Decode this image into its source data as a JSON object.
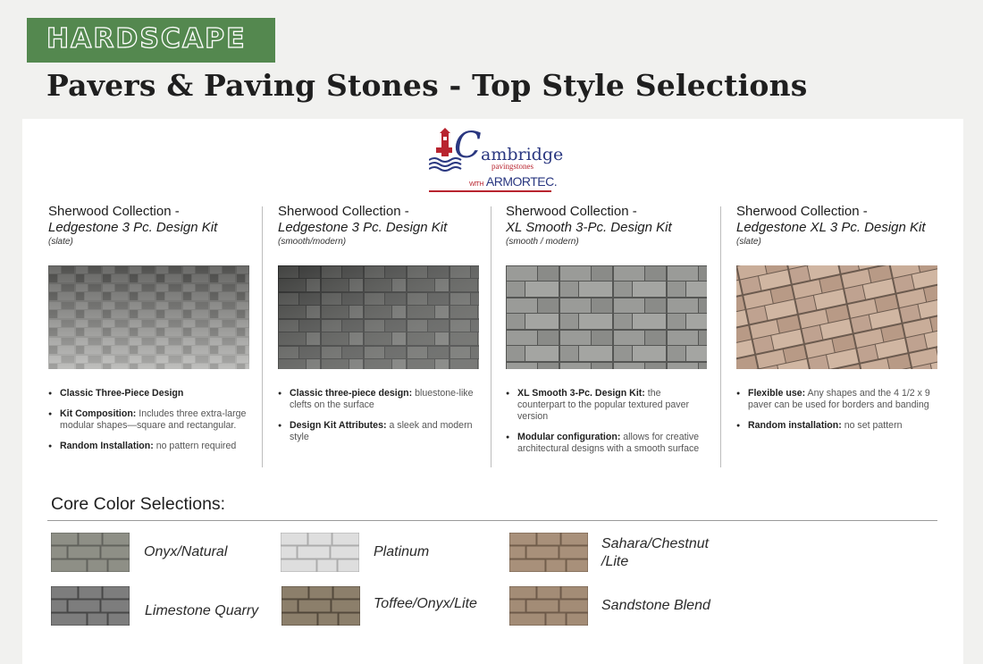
{
  "banner": {
    "label": "HARDSCAPE"
  },
  "title": "Pavers & Paving Stones - Top Style Selections",
  "logo": {
    "initial": "C",
    "name_rest": "ambridge",
    "sub": "pavingstones",
    "with": "WITH",
    "armor": "ARMORTEC."
  },
  "collections": [
    {
      "title": "Sherwood Collection  -",
      "subtitle": "Ledgestone 3 Pc. Design Kit",
      "note": "(slate)",
      "image": "paver-slate",
      "bullets": [
        {
          "bold": "Classic Three-Piece Design",
          "text": ""
        },
        {
          "bold": "Kit Composition:",
          "text": " Includes three extra-large modular shapes—square and rectangular."
        },
        {
          "bold": "Random Installation:",
          "text": " no pattern required"
        }
      ]
    },
    {
      "title": "Sherwood Collection  -",
      "subtitle": "Ledgestone 3 Pc. Design Kit",
      "note": "(smooth/modern)",
      "image": "paver-smooth",
      "bullets": [
        {
          "bold": "Classic three-piece design:",
          "text": " bluestone-like clefts on the surface"
        },
        {
          "bold": "Design Kit Attributes:",
          "text": " a sleek and modern style"
        }
      ]
    },
    {
      "title": "Sherwood Collection  -",
      "subtitle": "XL Smooth 3-Pc. Design Kit",
      "note": "(smooth / modern)",
      "image": "paver-xl-smooth",
      "bullets": [
        {
          "bold": "XL Smooth 3-Pc. Design Kit:",
          "text": " the counterpart to the popular textured paver version"
        },
        {
          "bold": "Modular configuration:",
          "text": " allows for creative architectural designs with a smooth surface"
        }
      ]
    },
    {
      "title": "Sherwood Collection  -",
      "subtitle": "Ledgestone XL 3 Pc. Design Kit",
      "note": "(slate)",
      "image": "paver-xl-slate",
      "bullets": [
        {
          "bold": "Flexible use:",
          "text": " Any shapes and the 4 1/2 x 9 paver can be used for borders and banding"
        },
        {
          "bold": "Random installation:",
          "text": " no set pattern"
        }
      ]
    }
  ],
  "core": {
    "title": "Core Color Selections:",
    "colors": [
      {
        "name": "Onyx/Natural",
        "base": "#8e8f86",
        "line": "#5f605a"
      },
      {
        "name": "Platinum",
        "base": "#dedede",
        "line": "#a9a9a9"
      },
      {
        "name": "Sahara/Chestnut\n/Lite",
        "base": "#a8907a",
        "line": "#6e5a48"
      },
      {
        "name": "Limestone Quarry",
        "base": "#7d7d7d",
        "line": "#444444"
      },
      {
        "name": "Toffee/Onyx/Lite",
        "base": "#8c7f6b",
        "line": "#4f4639"
      },
      {
        "name": "Sandstone Blend",
        "base": "#a38c76",
        "line": "#6a5646"
      }
    ]
  }
}
